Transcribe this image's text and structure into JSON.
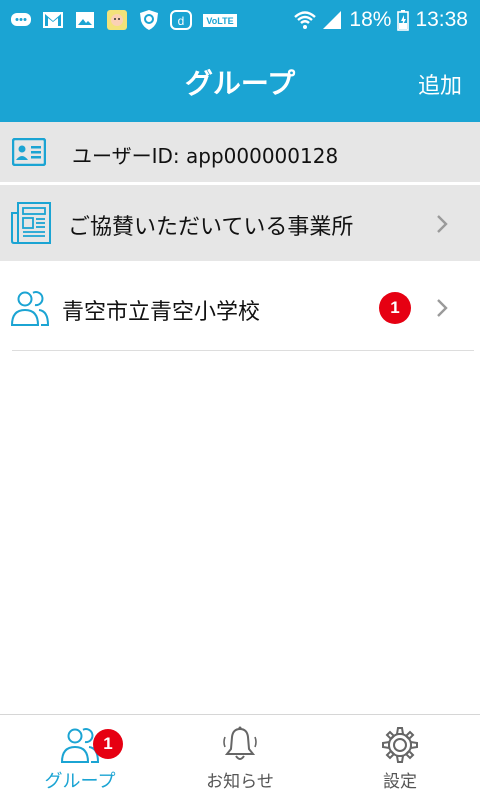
{
  "status_bar": {
    "battery": "18%",
    "time": "13:38",
    "icons": [
      "chat-icon",
      "gmail-icon",
      "image-icon",
      "app-icon",
      "shield-icon",
      "d-icon",
      "volte-icon",
      "wifi-icon",
      "signal-icon",
      "battery-icon"
    ]
  },
  "header": {
    "title": "グループ",
    "add_label": "追加"
  },
  "user": {
    "id_text": "ユーザーID: app000000128"
  },
  "sponsor": {
    "label": "ご協賛いただいている事業所"
  },
  "groups": [
    {
      "name": "青空市立青空小学校",
      "badge": "1"
    }
  ],
  "bottom_nav": {
    "items": [
      {
        "label": "グループ",
        "icon": "group-icon",
        "badge": "1",
        "active": true
      },
      {
        "label": "お知らせ",
        "icon": "bell-icon",
        "active": false
      },
      {
        "label": "設定",
        "icon": "gear-icon",
        "active": false
      }
    ]
  },
  "colors": {
    "primary": "#1ba4d3",
    "row_bg": "#e6e6e6",
    "badge": "#e60012",
    "chevron": "#9a9a9a"
  }
}
